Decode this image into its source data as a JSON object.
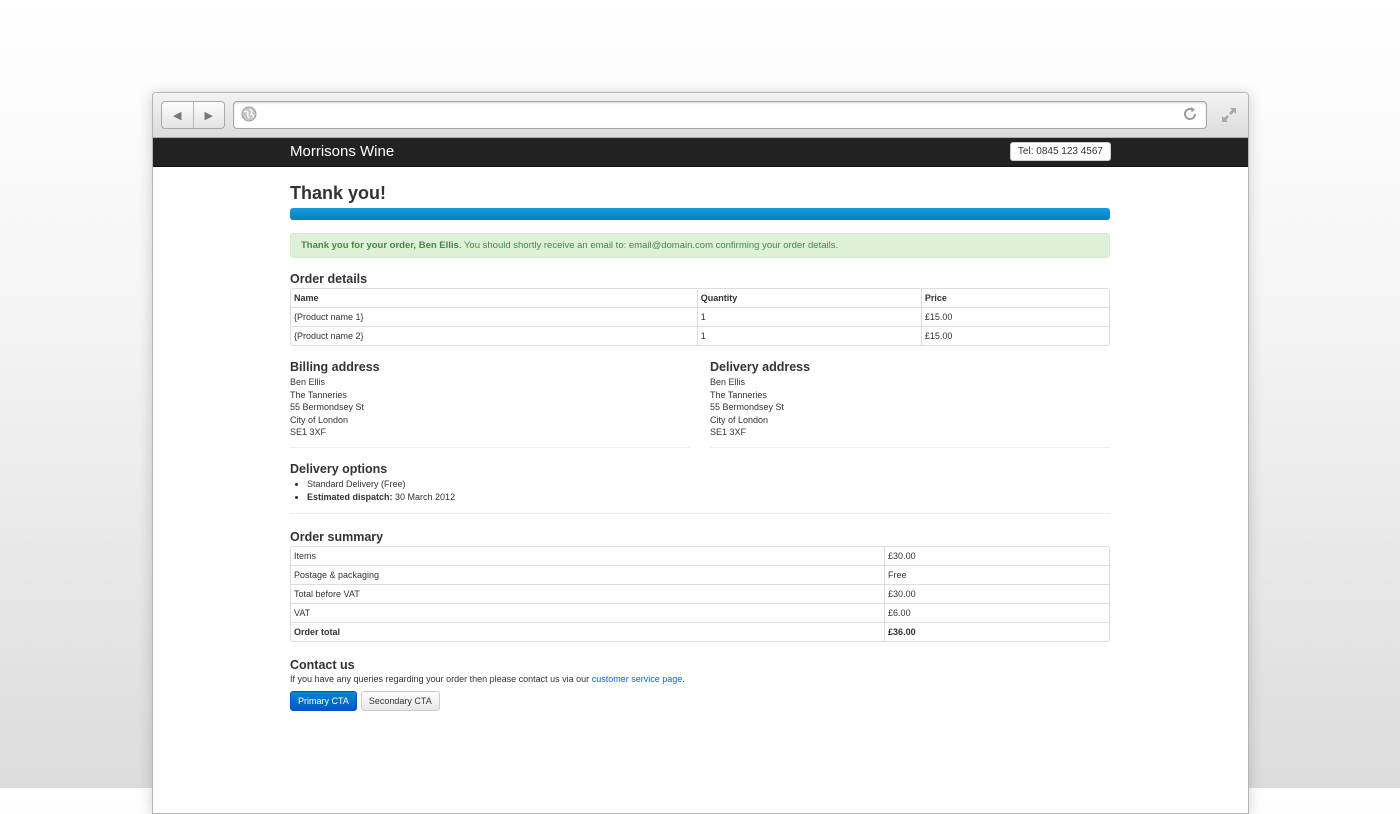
{
  "browser": {
    "back_icon": "back-arrow-icon",
    "forward_icon": "forward-arrow-icon",
    "url": ""
  },
  "header": {
    "brand": "Morrisons Wine",
    "tel": "Tel: 0845 123 4567"
  },
  "page": {
    "title": "Thank you!",
    "progress_percent": 100,
    "alert": {
      "bold": "Thank you for your order, Ben Ellis",
      "text": ". You should shortly receive an email to: email@domain.com confirming your order details."
    }
  },
  "order_details": {
    "heading": "Order details",
    "columns": [
      "Name",
      "Quantity",
      "Price"
    ],
    "rows": [
      [
        "{Product name 1}",
        "1",
        "£15.00"
      ],
      [
        "{Product name 2}",
        "1",
        "£15.00"
      ]
    ]
  },
  "billing": {
    "heading": "Billing address",
    "lines": [
      "Ben Ellis",
      "The Tanneries",
      "55 Bermondsey St",
      "City of London",
      "SE1 3XF"
    ]
  },
  "delivery": {
    "heading": "Delivery address",
    "lines": [
      "Ben Ellis",
      "The Tanneries",
      "55 Bermondsey St",
      "City of London",
      "SE1 3XF"
    ]
  },
  "delivery_options": {
    "heading": "Delivery options",
    "standard": "Standard Delivery (Free)",
    "dispatch_label": "Estimated dispatch:",
    "dispatch_value": " 30 March 2012"
  },
  "summary": {
    "heading": "Order summary",
    "rows": [
      [
        "Items",
        "£30.00"
      ],
      [
        "Postage & packaging",
        "Free"
      ],
      [
        "Total before VAT",
        "£30.00"
      ],
      [
        "VAT",
        "£6.00"
      ],
      [
        "Order total",
        "£36.00"
      ]
    ]
  },
  "contact": {
    "heading": "Contact us",
    "text": "If you have any queries regarding your order then please contact us via our ",
    "link": "customer service page",
    "suffix": ".",
    "primary_cta": "Primary CTA",
    "secondary_cta": "Secondary CTA"
  }
}
